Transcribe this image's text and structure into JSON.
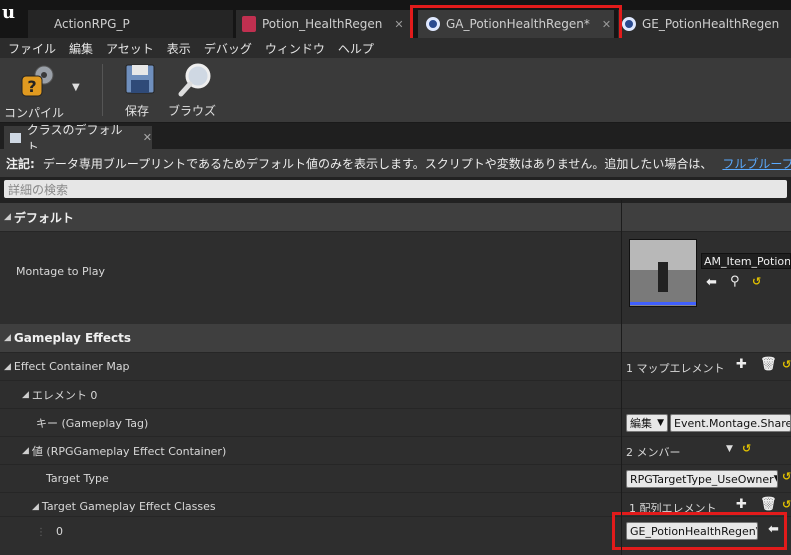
{
  "tabs": [
    {
      "label": "ActionRPG_P"
    },
    {
      "label": "Potion_HealthRegen"
    },
    {
      "label": "GA_PotionHealthRegen*"
    },
    {
      "label": "GE_PotionHealthRegen"
    }
  ],
  "menu": [
    "ファイル",
    "編集",
    "アセット",
    "表示",
    "デバッグ",
    "ウィンドウ",
    "ヘルプ"
  ],
  "toolbar": {
    "compile": "コンパイル",
    "save": "保存",
    "browse": "ブラウズ"
  },
  "details_tab": "クラスのデフォルト",
  "notice": {
    "prefix": "注記:",
    "text": "データ専用ブループリントであるためデフォルト値のみを表示します。スクリプトや変数はありません。追加したい場合は、",
    "link": "フルブループリントエディタを開く"
  },
  "search_placeholder": "詳細の検索",
  "default_section": {
    "title": "デフォルト",
    "montage_label": "Montage to Play",
    "montage_value": "AM_Item_Potion"
  },
  "gameplay_section": {
    "title": "Gameplay Effects",
    "effect_map_label": "Effect Container Map",
    "effect_map_value": "1 マップエレメント",
    "element0": "エレメント 0",
    "key_label": "キー (Gameplay Tag)",
    "key_edit": "編集",
    "key_value": "Event.Montage.Shared",
    "value_label": "値 (RPGGameplay Effect Container)",
    "members": "2 メンバー",
    "target_type_label": "Target Type",
    "target_type_value": "RPGTargetType_UseOwner",
    "classes_label": "Target Gameplay Effect Classes",
    "classes_value": "1 配列エレメント",
    "index_label": "0",
    "index_value": "GE_PotionHealthRegen"
  },
  "colors": {
    "highlight": "#e21b1b",
    "link": "#5aaaff",
    "reset_arrow": "#e0c000"
  }
}
